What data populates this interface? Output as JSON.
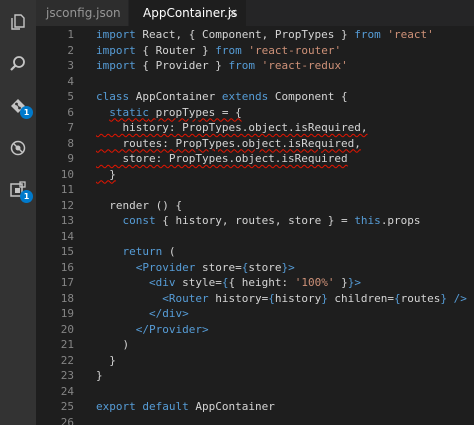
{
  "tabs": [
    {
      "label": "jsconfig.json"
    },
    {
      "label": "AppContainer.js",
      "close": "×"
    }
  ],
  "activity": {
    "icons": [
      "files-icon",
      "search-icon",
      "git-icon",
      "debug-icon",
      "extensions-icon"
    ],
    "badges": [
      "1",
      "1"
    ]
  },
  "editor": {
    "lines": [
      {
        "num": "1",
        "tokens": [
          [
            "kw",
            "import"
          ],
          [
            "plain",
            " React, { Component, PropTypes } "
          ],
          [
            "kw",
            "from"
          ],
          [
            "plain",
            " "
          ],
          [
            "str",
            "'react'"
          ]
        ]
      },
      {
        "num": "2",
        "tokens": [
          [
            "kw",
            "import"
          ],
          [
            "plain",
            " { Router } "
          ],
          [
            "kw",
            "from"
          ],
          [
            "plain",
            " "
          ],
          [
            "str",
            "'react-router'"
          ]
        ]
      },
      {
        "num": "3",
        "tokens": [
          [
            "kw",
            "import"
          ],
          [
            "plain",
            " { Provider } "
          ],
          [
            "kw",
            "from"
          ],
          [
            "plain",
            " "
          ],
          [
            "str",
            "'react-redux'"
          ]
        ]
      },
      {
        "num": "4",
        "tokens": []
      },
      {
        "num": "5",
        "tokens": [
          [
            "kw",
            "class"
          ],
          [
            "plain",
            " AppContainer "
          ],
          [
            "kw",
            "extends"
          ],
          [
            "plain",
            " Component {"
          ]
        ]
      },
      {
        "num": "6",
        "tokens": [
          [
            "plain",
            "  "
          ],
          [
            "kw squig",
            "static"
          ],
          [
            "plain squig",
            " propTypes = {"
          ]
        ]
      },
      {
        "num": "7",
        "tokens": [
          [
            "plain squig",
            "    history: PropTypes.object.isRequired,"
          ]
        ]
      },
      {
        "num": "8",
        "tokens": [
          [
            "plain squig",
            "    routes: PropTypes.object.isRequired,"
          ]
        ]
      },
      {
        "num": "9",
        "tokens": [
          [
            "plain squig",
            "    store: PropTypes.object.isRequired"
          ]
        ]
      },
      {
        "num": "10",
        "tokens": [
          [
            "plain squig",
            "  }"
          ]
        ]
      },
      {
        "num": "11",
        "tokens": []
      },
      {
        "num": "12",
        "tokens": [
          [
            "plain",
            "  render () {"
          ]
        ]
      },
      {
        "num": "13",
        "tokens": [
          [
            "plain",
            "    "
          ],
          [
            "kw",
            "const"
          ],
          [
            "plain",
            " { history, routes, store } = "
          ],
          [
            "kw",
            "this"
          ],
          [
            "plain",
            ".props"
          ]
        ]
      },
      {
        "num": "14",
        "tokens": []
      },
      {
        "num": "15",
        "tokens": [
          [
            "plain",
            "    "
          ],
          [
            "kw",
            "return"
          ],
          [
            "plain",
            " ("
          ]
        ]
      },
      {
        "num": "16",
        "tokens": [
          [
            "plain",
            "      "
          ],
          [
            "kw",
            "<Provider"
          ],
          [
            "plain",
            " store="
          ],
          [
            "kw",
            "{"
          ],
          [
            "plain",
            "store"
          ],
          [
            "kw",
            "}>"
          ]
        ]
      },
      {
        "num": "17",
        "tokens": [
          [
            "plain",
            "        "
          ],
          [
            "kw",
            "<div"
          ],
          [
            "plain",
            " style="
          ],
          [
            "kw",
            "{"
          ],
          [
            "plain",
            "{ height: "
          ],
          [
            "str",
            "'100%'"
          ],
          [
            "plain",
            " }"
          ],
          [
            "kw",
            "}>"
          ]
        ]
      },
      {
        "num": "18",
        "tokens": [
          [
            "plain",
            "          "
          ],
          [
            "kw",
            "<Router"
          ],
          [
            "plain",
            " history="
          ],
          [
            "kw",
            "{"
          ],
          [
            "plain",
            "history"
          ],
          [
            "kw",
            "}"
          ],
          [
            "plain",
            " children="
          ],
          [
            "kw",
            "{"
          ],
          [
            "plain",
            "routes"
          ],
          [
            "kw",
            "}"
          ],
          [
            "plain",
            " "
          ],
          [
            "kw",
            "/>"
          ]
        ]
      },
      {
        "num": "19",
        "tokens": [
          [
            "plain",
            "        "
          ],
          [
            "kw",
            "</div>"
          ]
        ]
      },
      {
        "num": "20",
        "tokens": [
          [
            "plain",
            "      "
          ],
          [
            "kw",
            "</Provider>"
          ]
        ]
      },
      {
        "num": "21",
        "tokens": [
          [
            "plain",
            "    )"
          ]
        ]
      },
      {
        "num": "22",
        "tokens": [
          [
            "plain",
            "  }"
          ]
        ]
      },
      {
        "num": "23",
        "tokens": [
          [
            "plain",
            "}"
          ]
        ]
      },
      {
        "num": "24",
        "tokens": []
      },
      {
        "num": "25",
        "tokens": [
          [
            "kw",
            "export"
          ],
          [
            "plain",
            " "
          ],
          [
            "kw",
            "default"
          ],
          [
            "plain",
            " AppContainer"
          ]
        ]
      },
      {
        "num": "26",
        "tokens": []
      }
    ]
  }
}
